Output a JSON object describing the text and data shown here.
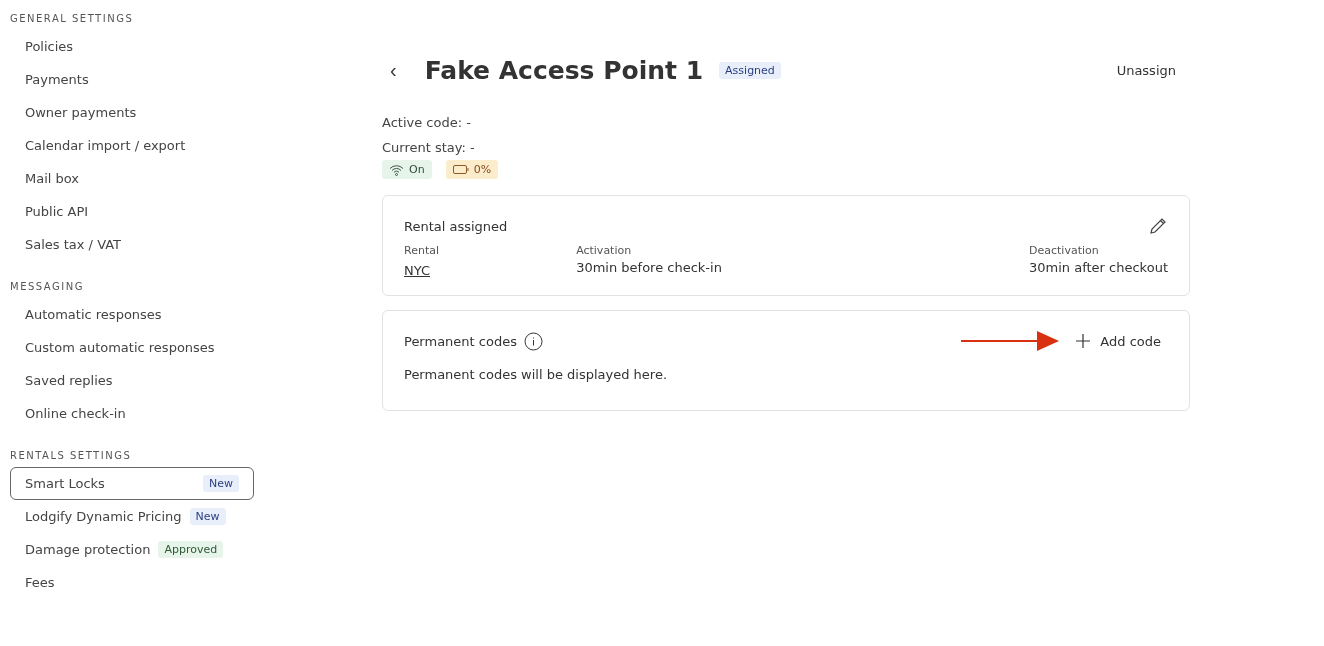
{
  "sidebar": {
    "sections": [
      {
        "heading": "GENERAL SETTINGS",
        "items": [
          {
            "label": "Policies",
            "selected": false
          },
          {
            "label": "Payments",
            "selected": false
          },
          {
            "label": "Owner payments",
            "selected": false
          },
          {
            "label": "Calendar import / export",
            "selected": false
          },
          {
            "label": "Mail box",
            "selected": false
          },
          {
            "label": "Public API",
            "selected": false
          },
          {
            "label": "Sales tax / VAT",
            "selected": false
          }
        ]
      },
      {
        "heading": "MESSAGING",
        "items": [
          {
            "label": "Automatic responses",
            "selected": false
          },
          {
            "label": "Custom automatic responses",
            "selected": false
          },
          {
            "label": "Saved replies",
            "selected": false
          },
          {
            "label": "Online check-in",
            "selected": false
          }
        ]
      },
      {
        "heading": "RENTALS SETTINGS",
        "items": [
          {
            "label": "Smart Locks",
            "selected": true,
            "badge": {
              "text": "New",
              "kind": "new"
            }
          },
          {
            "label": "Lodgify Dynamic Pricing",
            "selected": false,
            "badge": {
              "text": "New",
              "kind": "new"
            }
          },
          {
            "label": "Damage protection",
            "selected": false,
            "badge": {
              "text": "Approved",
              "kind": "approved"
            }
          },
          {
            "label": "Fees",
            "selected": false
          }
        ]
      }
    ]
  },
  "header": {
    "back": "‹",
    "title": "Fake Access Point 1",
    "status": "Assigned",
    "action": "Unassign"
  },
  "details": [
    "Active code: -",
    "Current stay: -"
  ],
  "chips": [
    {
      "kind": "wifi",
      "text": "On"
    },
    {
      "kind": "battery",
      "text": "0%"
    }
  ],
  "rental_card": {
    "title": "Rental assigned",
    "fields": [
      {
        "label": "Rental",
        "value": "NYC",
        "kind": "link"
      },
      {
        "label": "Activation",
        "value": "30min before check-in",
        "kind": "text"
      },
      {
        "label": "Deactivation",
        "value": "30min after checkout",
        "kind": "text"
      }
    ]
  },
  "codes_card": {
    "title": "Permanent codes",
    "action": "Add code",
    "empty": "Permanent codes will be displayed here."
  }
}
